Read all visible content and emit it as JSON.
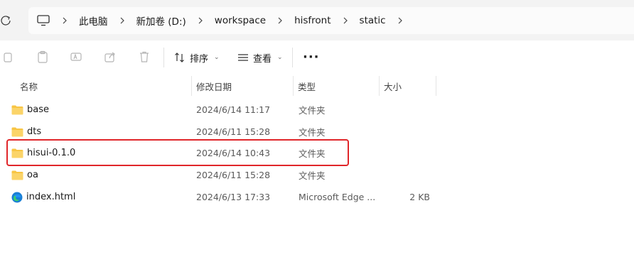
{
  "breadcrumb": [
    "此电脑",
    "新加卷 (D:)",
    "workspace",
    "hisfront",
    "static"
  ],
  "toolbar": {
    "sort_label": "排序",
    "view_label": "查看",
    "more_label": "···"
  },
  "columns": {
    "name": "名称",
    "date": "修改日期",
    "type": "类型",
    "size": "大小"
  },
  "files": [
    {
      "name": "base",
      "date": "2024/6/14 11:17",
      "type": "文件夹",
      "size": "",
      "icon": "folder-icon"
    },
    {
      "name": "dts",
      "date": "2024/6/11 15:28",
      "type": "文件夹",
      "size": "",
      "icon": "folder-icon"
    },
    {
      "name": "hisui-0.1.0",
      "date": "2024/6/14 10:43",
      "type": "文件夹",
      "size": "",
      "icon": "folder-icon"
    },
    {
      "name": "oa",
      "date": "2024/6/11 15:28",
      "type": "文件夹",
      "size": "",
      "icon": "folder-icon"
    },
    {
      "name": "index.html",
      "date": "2024/6/13 17:33",
      "type": "Microsoft Edge ...",
      "size": "2 KB",
      "icon": "edge-icon"
    }
  ],
  "colors": {
    "highlight": "#e0262a",
    "folder": "#f8c544"
  }
}
